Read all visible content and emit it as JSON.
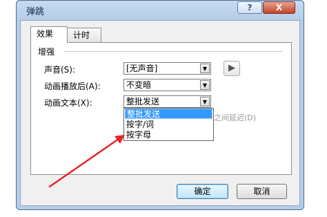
{
  "window": {
    "title": "弹跳",
    "help_label": "?",
    "close_label": "X"
  },
  "tabs": [
    {
      "label": "效果",
      "active": true
    },
    {
      "label": "计时",
      "active": false
    }
  ],
  "group": {
    "label": "增强"
  },
  "fields": {
    "sound": {
      "label": "声音(S):",
      "value": "[无声音]"
    },
    "after_animation": {
      "label": "动画播放后(A):",
      "value": "不变暗"
    },
    "animate_text": {
      "label": "动画文本(X):",
      "value": "整批发送"
    }
  },
  "partial_hidden_text": "之间延迟(D)",
  "dropdown_options": [
    "整批发送",
    "按字/词",
    "按字母"
  ],
  "selected_option_index": 0,
  "buttons": {
    "ok": "确定",
    "cancel": "取消"
  },
  "icons": {
    "speaker": "speaker-icon",
    "dropdown_arrow": "chevron-down-icon"
  },
  "colors": {
    "selection": "#3399ff",
    "annotation_arrow": "#e8232a",
    "frame": "#b6cde8"
  }
}
